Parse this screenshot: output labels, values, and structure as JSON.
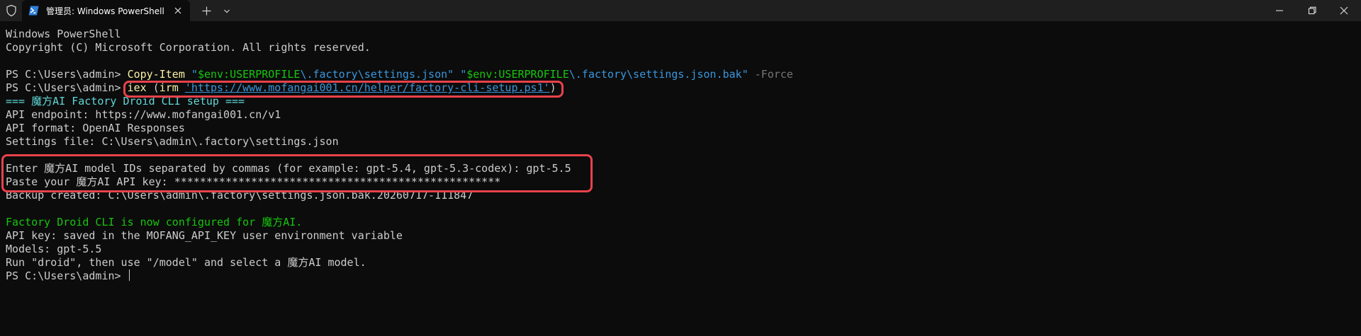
{
  "window": {
    "tab_title": "管理员: Windows PowerShell",
    "tab_icon": "powershell-icon"
  },
  "terminal": {
    "banner_1": "Windows PowerShell",
    "banner_2": "Copyright (C) Microsoft Corporation. All rights reserved.",
    "prompt": "PS C:\\Users\\admin> ",
    "cmd1": {
      "cmdlet": "Copy-Item",
      "arg1_q": "\"",
      "arg1_var": "$env:USERPROFILE",
      "arg1_rest": "\\.factory\\settings.json\"",
      "arg2_q": "\"",
      "arg2_var": "$env:USERPROFILE",
      "arg2_rest": "\\.factory\\settings.json.bak\"",
      "param": "-Force"
    },
    "cmd2": {
      "iex": "iex",
      "open": " (",
      "irm": "irm",
      "url": "'https://www.mofangai001.cn/helper/factory-cli-setup.ps1'",
      "close": ")"
    },
    "setup_header": "=== 魔方AI Factory Droid CLI setup ===",
    "endpoint_line": "API endpoint: https://www.mofangai001.cn/v1",
    "format_line": "API format: OpenAI Responses",
    "settings_line": "Settings file: C:\\Users\\admin\\.factory\\settings.json",
    "model_prompt_line": "Enter 魔方AI model IDs separated by commas (for example: gpt-5.4, gpt-5.3-codex): gpt-5.5",
    "api_key_line": "Paste your 魔方AI API key: ***************************************************",
    "backup_line": "Backup created: C:\\Users\\admin\\.factory\\settings.json.bak.20260717-111847",
    "configured_line": "Factory Droid CLI is now configured for 魔方AI.",
    "saved_line": "API key: saved in the MOFANG_API_KEY user environment variable",
    "models_line": "Models: gpt-5.5",
    "run_line": "Run \"droid\", then use \"/model\" and select a 魔方AI model.",
    "final_prompt": "PS C:\\Users\\admin> "
  },
  "colors": {
    "background": "#0c0c0c",
    "titlebar": "#1f1f1f",
    "text": "#cccccc",
    "cmdlet": "#f9f1a5",
    "string": "#3a96dd",
    "variable": "#16c60c",
    "parameter": "#767676",
    "header_cyan": "#61d6d6",
    "success_green": "#16c60c",
    "highlight_red": "#e8424a"
  }
}
